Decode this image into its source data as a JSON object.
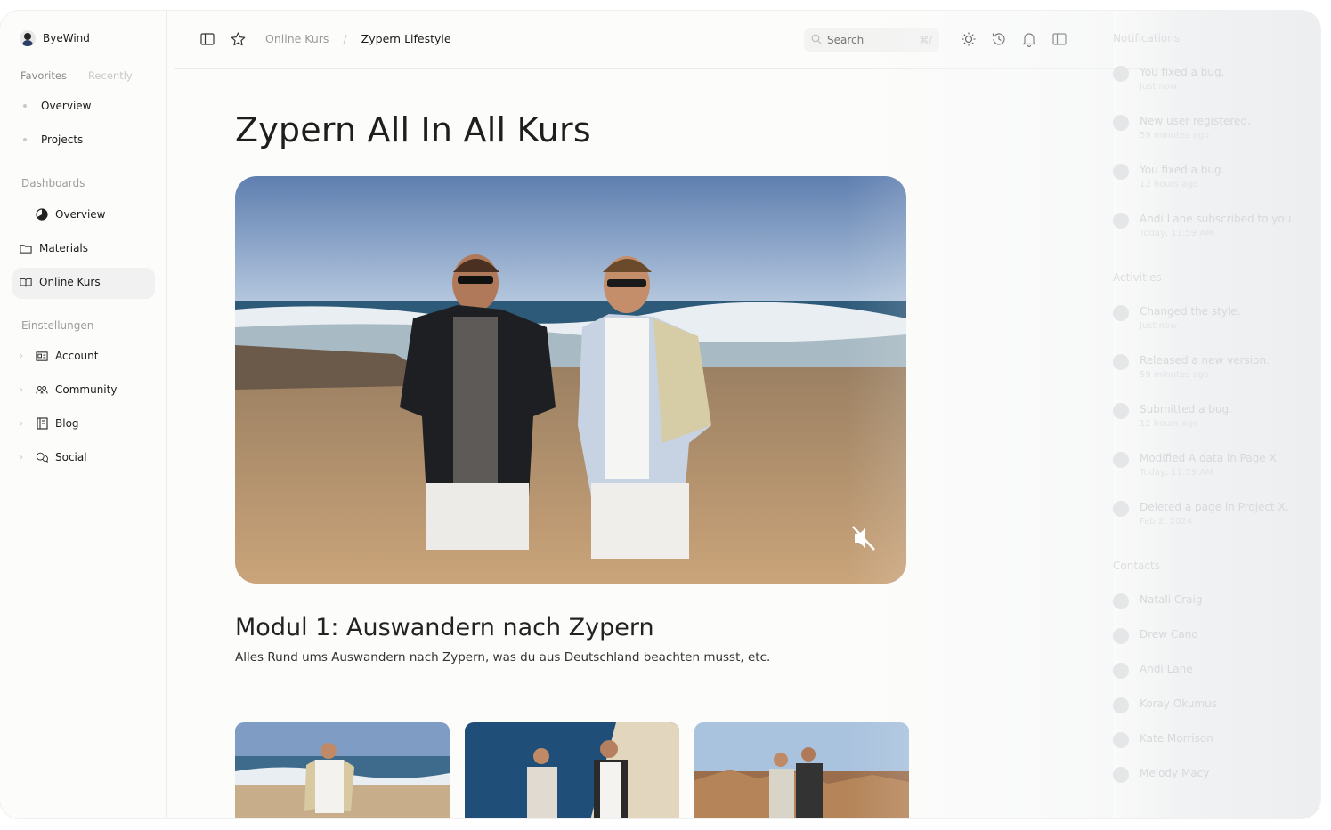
{
  "sidebar": {
    "user_name": "ByeWind",
    "tabs": [
      "Favorites",
      "Recently"
    ],
    "favorites": [
      "Overview",
      "Projects"
    ],
    "dashboards_label": "Dashboards",
    "dashboards": [
      {
        "label": "Overview",
        "icon": "pie-chart-icon"
      },
      {
        "label": "Materials",
        "icon": "folder-icon"
      },
      {
        "label": "Online Kurs",
        "icon": "book-open-icon",
        "active": true
      }
    ],
    "settings_label": "Einstellungen",
    "settings": [
      {
        "label": "Account",
        "icon": "id-card-icon"
      },
      {
        "label": "Community",
        "icon": "users-icon"
      },
      {
        "label": "Blog",
        "icon": "notebook-icon"
      },
      {
        "label": "Social",
        "icon": "chat-bubbles-icon"
      }
    ]
  },
  "topbar": {
    "breadcrumb": [
      "Online Kurs",
      "/",
      "Zypern Lifestyle"
    ],
    "search_placeholder": "Search",
    "search_shortcut": "⌘/"
  },
  "main": {
    "title": "Zypern All In All Kurs",
    "module_title": "Modul 1: Auswandern nach Zypern",
    "module_desc": "Alles Rund ums Auswandern nach Zypern, was du aus Deutschland beachten musst, etc."
  },
  "right_panel": {
    "notifications_label": "Notifications",
    "notifications": [
      {
        "text": "You fixed a bug.",
        "time": "Just now"
      },
      {
        "text": "New user registered.",
        "time": "59 minutes ago"
      },
      {
        "text": "You fixed a bug.",
        "time": "12 hours ago"
      },
      {
        "text": "Andi Lane subscribed to you.",
        "time": "Today, 11:59 AM"
      }
    ],
    "activities_label": "Activities",
    "activities": [
      {
        "text": "Changed the style.",
        "time": "Just now"
      },
      {
        "text": "Released a new version.",
        "time": "59 minutes ago"
      },
      {
        "text": "Submitted a bug.",
        "time": "12 hours ago"
      },
      {
        "text": "Modified A data in Page X.",
        "time": "Today, 11:59 AM"
      },
      {
        "text": "Deleted a page in Project X.",
        "time": "Feb 2, 2024"
      }
    ],
    "contacts_label": "Contacts",
    "contacts": [
      "Natali Craig",
      "Drew Cano",
      "Andi Lane",
      "Koray Okumus",
      "Kate Morrison",
      "Melody Macy"
    ]
  }
}
